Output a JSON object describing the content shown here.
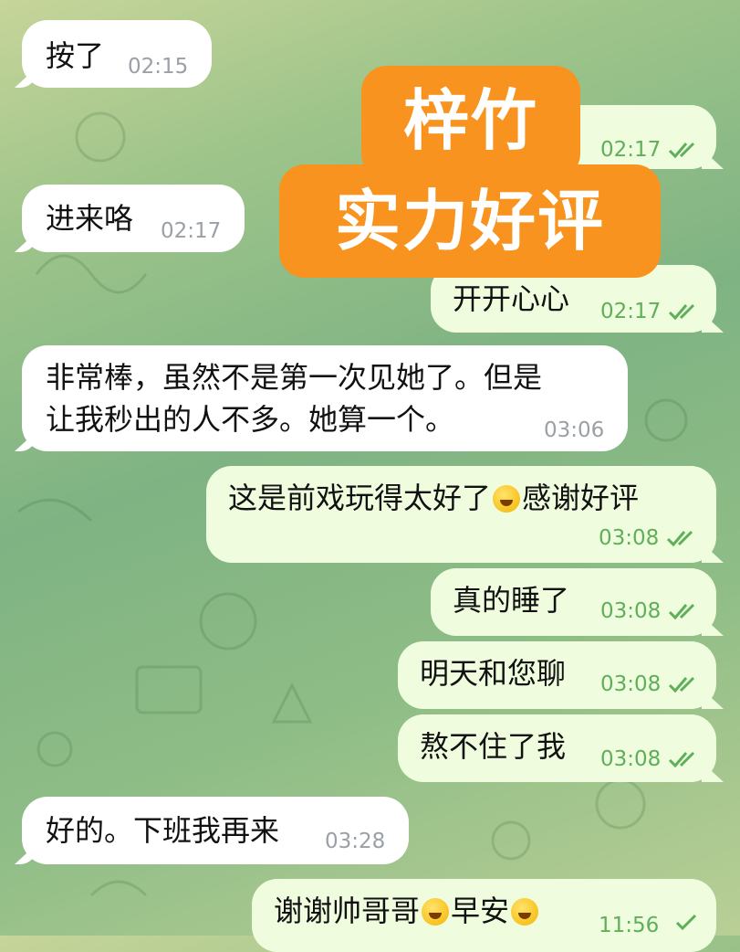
{
  "messages": [
    {
      "text": "按了",
      "time": "02:15"
    },
    {
      "text": "",
      "time": "02:17"
    },
    {
      "text": "进来咯",
      "time": "02:17"
    },
    {
      "text": "开开心心",
      "time": "02:17"
    },
    {
      "text_line1": "非常棒，虽然不是第一次见她了。但是",
      "text_line2": "让我秒出的人不多。她算一个。",
      "time": "03:06"
    },
    {
      "text_a": "这是前戏玩得太好了",
      "text_b": "感谢好评",
      "emoji": "laughing-tears",
      "time": "03:08"
    },
    {
      "text": "真的睡了",
      "time": "03:08"
    },
    {
      "text": "明天和您聊",
      "time": "03:08"
    },
    {
      "text": "熬不住了我",
      "time": "03:08"
    },
    {
      "text": "好的。下班我再来",
      "time": "03:28"
    },
    {
      "text_a": "谢谢帅哥哥",
      "text_b": "早安",
      "emoji_a": "grinning",
      "emoji_b": "kissing-heart",
      "time": "11:56"
    }
  ],
  "overlay": {
    "line1": "梓竹",
    "line2": "实力好评"
  },
  "colors": {
    "incoming": "#ffffff",
    "outgoing": "#effdde",
    "time_out": "#5faf5a",
    "time_in": "#9aa0a6",
    "overlay": "#f7931e"
  }
}
